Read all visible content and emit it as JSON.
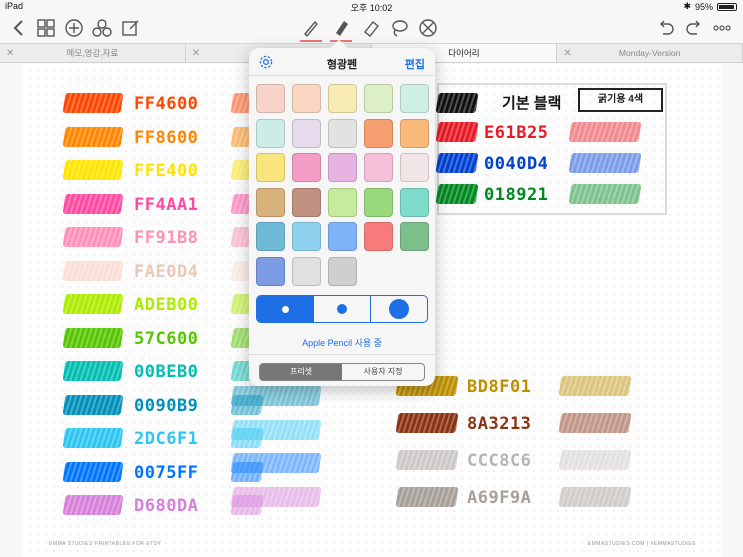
{
  "status": {
    "device": "iPad",
    "time": "오후 10:02",
    "battery": "95%"
  },
  "toolbar": {
    "left_icons": [
      "back-icon",
      "grid-icon",
      "add-icon",
      "shapes-icon",
      "compose-icon"
    ],
    "tools": [
      "pen-icon",
      "highlighter-icon",
      "eraser-icon",
      "lasso-icon",
      "no-scroll-icon"
    ],
    "right_icons": [
      "undo-icon",
      "redo-icon",
      "more-icon"
    ]
  },
  "tabs": [
    {
      "label": "메모,영감,자료",
      "active": false
    },
    {
      "label": "",
      "active": false
    },
    {
      "label": "다이어리",
      "active": true
    },
    {
      "label": "Monday-Version",
      "active": false
    }
  ],
  "page": {
    "footer_left": "EMMA STUDIES PRINTABLES FOR ETSY",
    "footer_right": "EMMASTUDIES.COM | #EMMASTUDIES",
    "legend_label": "기본 블랙",
    "legend_tag": "굵기용 4색",
    "left_column": [
      {
        "hex": "FF4600",
        "color": "#FF4600"
      },
      {
        "hex": "FF8600",
        "color": "#FF8600"
      },
      {
        "hex": "FFE400",
        "color": "#FFE400"
      },
      {
        "hex": "FF4AA1",
        "color": "#FF4AA1"
      },
      {
        "hex": "FF91B8",
        "color": "#FF91B8"
      },
      {
        "hex": "FAE0D4",
        "color": "#FAE0D4"
      },
      {
        "hex": "ADEB00",
        "color": "#ADEB00"
      },
      {
        "hex": "57C600",
        "color": "#57C600"
      },
      {
        "hex": "00BEB0",
        "color": "#00BEB0"
      },
      {
        "hex": "0090B9",
        "color": "#0090B9"
      },
      {
        "hex": "2DC6F1",
        "color": "#2DC6F1"
      },
      {
        "hex": "0075FF",
        "color": "#0075FF"
      },
      {
        "hex": "D680DA",
        "color": "#D680DA"
      }
    ],
    "right_top": [
      {
        "hex": "E61B25",
        "color": "#E61B25"
      },
      {
        "hex": "0040D4",
        "color": "#0040D4"
      },
      {
        "hex": "018921",
        "color": "#018921"
      }
    ],
    "right_bottom": [
      {
        "hex": "BD8F01",
        "color": "#BD8F01"
      },
      {
        "hex": "8A3213",
        "color": "#8A3213"
      },
      {
        "hex": "CCC8C6",
        "color": "#CCC8C6"
      },
      {
        "hex": "A69F9A",
        "color": "#A69F9A"
      }
    ]
  },
  "popover": {
    "title": "형광펜",
    "edit": "편집",
    "palette": [
      "#F7D3C9",
      "#F9D6C2",
      "#F8EBB4",
      "#DDEFC7",
      "#CFEFE4",
      "#CCEDE7",
      "#E5DBEC",
      "#E2E2E2",
      "#F89F72",
      "#F9B97A",
      "#F8E67C",
      "#F49CC3",
      "#E7B3E0",
      "#F6BFD8",
      "#F2E5E5",
      "#D8B27C",
      "#C09080",
      "#C6EB9C",
      "#9AD87C",
      "#7FDCCB",
      "#6FBAD7",
      "#8FD2F0",
      "#7EB3F7",
      "#F77B7B",
      "#7EBE8B",
      "#7B9BE3",
      "#E0E0E0",
      "#CFCFCF"
    ],
    "pencil_note": "Apple Pencil 사용 중",
    "preset_tabs": [
      "프리셋",
      "사용자 지정"
    ]
  }
}
